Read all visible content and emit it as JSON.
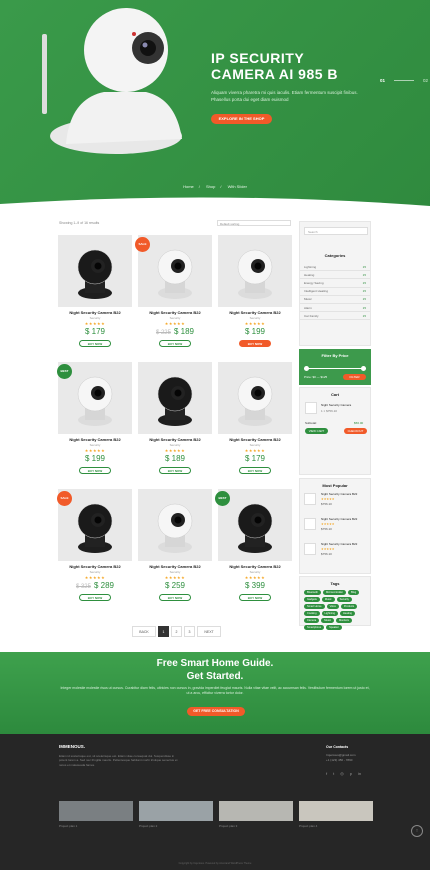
{
  "hero": {
    "title_line1": "IP SECURITY",
    "title_line2": "CAMERA AI 985 B",
    "text": "Aliquam viverra pharetra mi quis iaculis. Etiam fermentum suscipit finibus. Phasellus porta dui eget diam euismod",
    "cta": "EXPLORE IN THE SHOP",
    "slides": [
      "01",
      "02",
      "03"
    ]
  },
  "breadcrumb": [
    "Home",
    "Shop",
    "With Slider"
  ],
  "shop": {
    "showing": "Showing 1–9 of 16 results",
    "sort": "Default sorting"
  },
  "products": [
    {
      "name": "Night Security Camera B22",
      "category": "Security",
      "stars": "★★★★★",
      "price": "$ 179",
      "old": "",
      "badge": "",
      "buy": "BUY NOW",
      "buy_style": "outline"
    },
    {
      "name": "Night Security Camera B22",
      "category": "Security",
      "stars": "★★★★★",
      "price": "$ 189",
      "old": "$ 225",
      "badge": "SALE",
      "buy": "BUY NOW",
      "buy_style": "outline"
    },
    {
      "name": "Night Security Camera B22",
      "category": "Security",
      "stars": "★★★★★",
      "price": "$ 199",
      "old": "",
      "badge": "",
      "buy": "BUY NOW",
      "buy_style": "orange"
    },
    {
      "name": "Night Security Camera B22",
      "category": "Security",
      "stars": "★★★★★",
      "price": "$ 199",
      "old": "",
      "badge": "BEST",
      "buy": "BUY NOW",
      "buy_style": "outline"
    },
    {
      "name": "Night Security Camera B22",
      "category": "Security",
      "stars": "★★★★★",
      "price": "$ 189",
      "old": "",
      "badge": "",
      "buy": "BUY NOW",
      "buy_style": "outline"
    },
    {
      "name": "Night Security Camera B22",
      "category": "Security",
      "stars": "★★★★★",
      "price": "$ 179",
      "old": "",
      "badge": "",
      "buy": "BUY NOW",
      "buy_style": "outline"
    },
    {
      "name": "Night Security Camera B22",
      "category": "Security",
      "stars": "★★★★★",
      "price": "$ 289",
      "old": "$ 325",
      "badge": "SALE",
      "buy": "BUY NOW",
      "buy_style": "outline"
    },
    {
      "name": "Night Security Camera B22",
      "category": "Security",
      "stars": "★★★★★",
      "price": "$ 259",
      "old": "",
      "badge": "",
      "buy": "BUY NOW",
      "buy_style": "outline"
    },
    {
      "name": "Night Security Camera B22",
      "category": "Security",
      "stars": "★★★★★",
      "price": "$ 399",
      "old": "",
      "badge": "BEST",
      "buy": "BUY NOW",
      "buy_style": "outline"
    }
  ],
  "sidebar": {
    "search_placeholder": "Search",
    "categories_title": "Categories",
    "categories": [
      {
        "name": "Lightning",
        "count": "15"
      },
      {
        "name": "Heating",
        "count": "15"
      },
      {
        "name": "Energy Saving",
        "count": "15"
      },
      {
        "name": "Intelligent Heating",
        "count": "15"
      },
      {
        "name": "Music",
        "count": "15"
      },
      {
        "name": "Alarm",
        "count": "15"
      },
      {
        "name": "Car Family",
        "count": "15"
      }
    ],
    "filter_title": "Filter By Price",
    "filter_range": "Price: $0 — $125",
    "filter_btn": "FILTER",
    "cart_title": "Cart",
    "cart_item": "Night Security Camera",
    "cart_qty": "1 × $756.10",
    "subtotal_label": "Subtotal:",
    "subtotal": "$56.00",
    "view_cart": "VIEW CART",
    "checkout": "CHECKOUT",
    "popular_title": "Most Popular",
    "popular": [
      {
        "name": "Night Security Camera B22",
        "price": "$756.10"
      },
      {
        "name": "Night Security Camera B22",
        "price": "$756.10"
      },
      {
        "name": "Night Security Camera B22",
        "price": "$756.10"
      }
    ],
    "tags_title": "Tags",
    "tags": [
      "Bluetooth",
      "Microcontroller",
      "Blog",
      "Gadgets",
      "Music",
      "Security",
      "Smart Home",
      "Voice",
      "Products",
      "Cooking",
      "Lightning",
      "Heating",
      "Camera",
      "Music",
      "Monitors",
      "Smartphone",
      "Speaker"
    ]
  },
  "pagination": {
    "prev": "BACK",
    "pages": [
      "1",
      "2",
      "3"
    ],
    "next": "NEXT"
  },
  "guide": {
    "line1": "Free Smart Home Guide.",
    "line2": "Get Started.",
    "text": "Integer molestie molestie risus ut cursus. Curabitur diam felis, ultricies non cursus in, gravida imperdiet feugiat mauris. Nulla vitae vitae velit, ac accumsan felis. Vestibulum fermentum lorem ut justo et, ut a arcu, efficitur viverra tortor dolor.",
    "cta": "GET FREE CONSULTATION"
  },
  "footer": {
    "logo": "IMMENOUS.",
    "about": "Etiam id scelerisque est, sit scelerisque est. Etiam vitae consequat dui. Suspendisse in potent lorem a. Sed nec fringilla mauris. Pellentesque habitant morbi tristique senectus et netus et malesuada fames.",
    "contact_title": "Our Contacts",
    "email": "Imjenious@gmail.com",
    "phone": "+1 (123) 456 - 7890",
    "projects": [
      "Project plan 1",
      "Project plan 2",
      "Project plan 3",
      "Project plan 4"
    ],
    "copyright": "Copyright by Imjenious. Powered by Ancorand WordPress Theme"
  },
  "colors": {
    "green": "#2e8f3e",
    "orange": "#f15a29",
    "dark": "#262626"
  }
}
